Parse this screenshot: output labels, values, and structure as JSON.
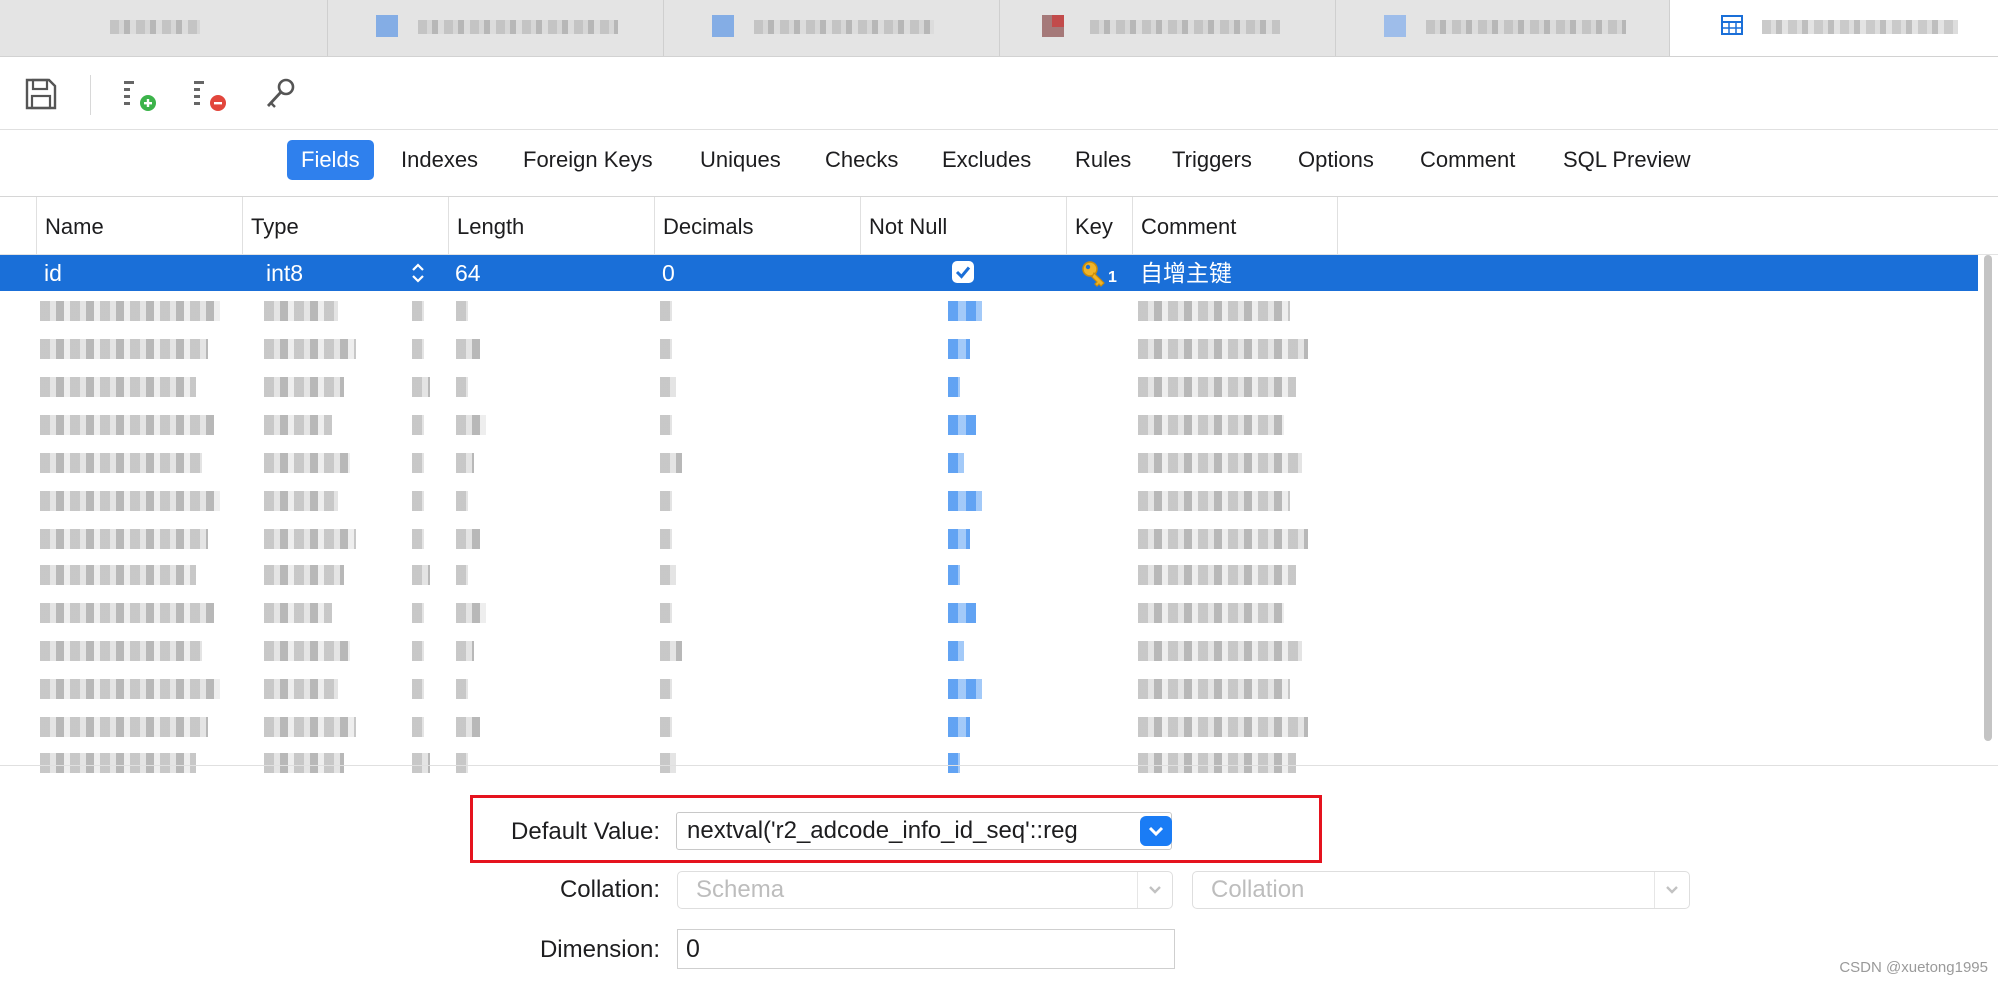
{
  "sub_tabs": [
    "Fields",
    "Indexes",
    "Foreign Keys",
    "Uniques",
    "Checks",
    "Excludes",
    "Rules",
    "Triggers",
    "Options",
    "Comment",
    "SQL Preview"
  ],
  "active_sub_tab": "Fields",
  "columns": [
    "Name",
    "Type",
    "Length",
    "Decimals",
    "Not Null",
    "Key",
    "Comment"
  ],
  "selected_row": {
    "name": "id",
    "type": "int8",
    "length": "64",
    "decimals": "0",
    "not_null": true,
    "key": "1",
    "comment": "自增主键"
  },
  "properties": {
    "default_value_label": "Default Value:",
    "default_value": "nextval('r2_adcode_info_id_seq'::reg",
    "collation_label": "Collation:",
    "schema_placeholder": "Schema",
    "collation_placeholder": "Collation",
    "dimension_label": "Dimension:",
    "dimension_value": "0"
  },
  "watermark": "CSDN @xuetong1995",
  "colors": {
    "accent": "#1a6fd8",
    "tab_active": "#2f80ed",
    "highlight_box": "#e5131e"
  }
}
